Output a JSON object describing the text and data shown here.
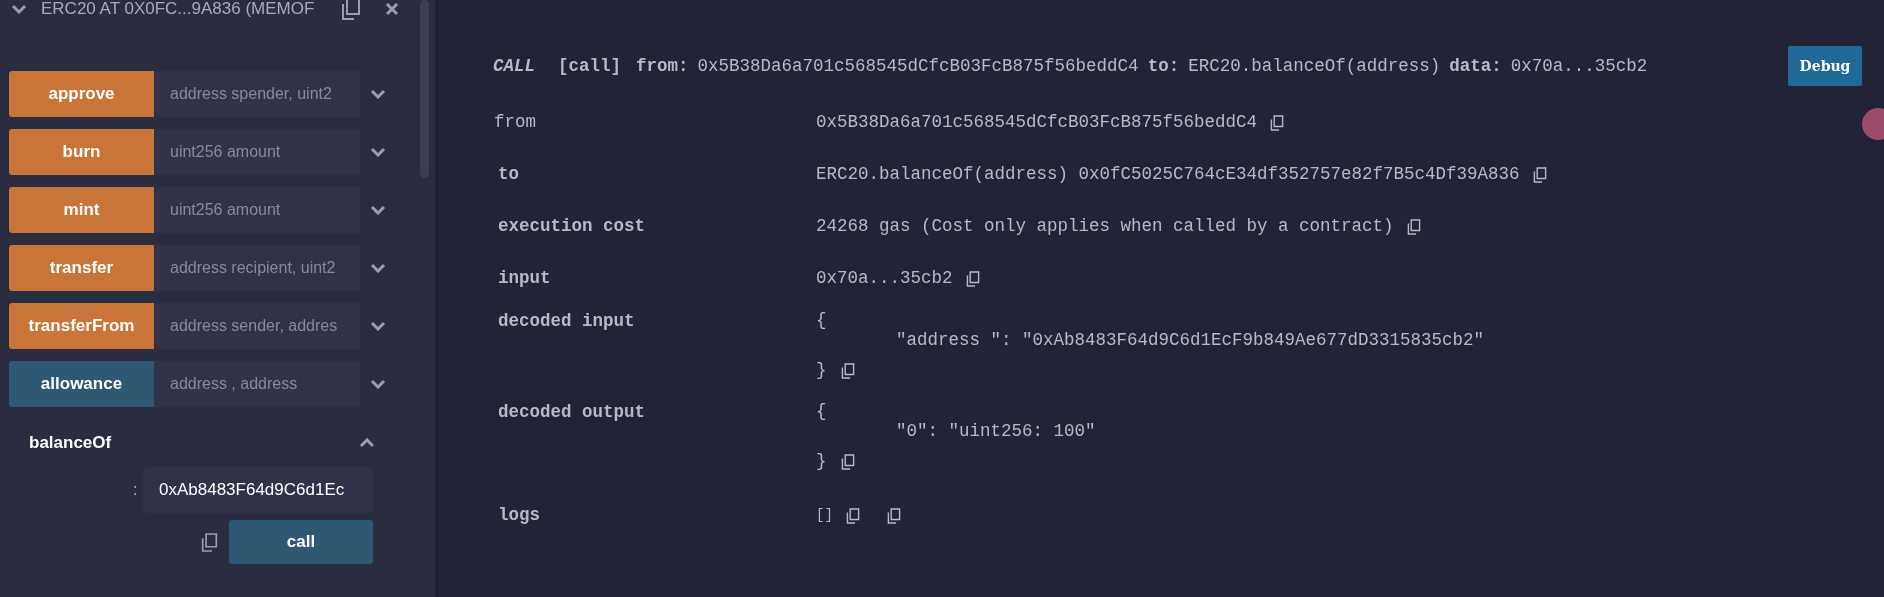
{
  "instance": {
    "title": "ERC20 AT 0X0FC...9A836 (MEMOF",
    "expanded": true
  },
  "functions": [
    {
      "name": "approve",
      "kind": "transact",
      "placeholder": "address spender, uint2"
    },
    {
      "name": "burn",
      "kind": "transact",
      "placeholder": "uint256 amount"
    },
    {
      "name": "mint",
      "kind": "transact",
      "placeholder": "uint256 amount"
    },
    {
      "name": "transfer",
      "kind": "transact",
      "placeholder": "address recipient, uint2"
    },
    {
      "name": "transferFrom",
      "kind": "transact",
      "placeholder": "address sender, addres"
    },
    {
      "name": "allowance",
      "kind": "call",
      "placeholder": "address , address"
    }
  ],
  "open_function": {
    "name": "balanceOf",
    "expanded": true,
    "param_label": ":",
    "value": "0xAb8483F64d9C6d1Ec",
    "button": "call"
  },
  "log": {
    "tag": "CALL",
    "type": "[call]",
    "from_label": "from:",
    "from": "0x5B38Da6a701c568545dCfcB03FcB875f56beddC4",
    "to_label": "to:",
    "to": "ERC20.balanceOf(address)",
    "data_label": "data:",
    "data": "0x70a...35cb2",
    "debug": "Debug"
  },
  "details": [
    {
      "label": "from",
      "emphasis": false,
      "kind": "text",
      "value": "0x5B38Da6a701c568545dCfcB03FcB875f56beddC4"
    },
    {
      "label": "to",
      "emphasis": true,
      "kind": "text",
      "value": "ERC20.balanceOf(address) 0x0fC5025C764cE34df352757e82f7B5c4Df39A836"
    },
    {
      "label": "execution cost",
      "emphasis": true,
      "kind": "text",
      "value": "24268 gas (Cost only applies when called by a contract)"
    },
    {
      "label": "input",
      "emphasis": true,
      "kind": "text",
      "value": "0x70a...35cb2"
    },
    {
      "label": "decoded input",
      "emphasis": true,
      "kind": "object",
      "open": "{",
      "lines": [
        "\"address \": \"0xAb8483F64d9C6d1EcF9b849Ae677dD3315835cb2\""
      ],
      "close": "}"
    },
    {
      "label": "decoded output",
      "emphasis": true,
      "kind": "object",
      "open": "{",
      "lines": [
        "\"0\": \"uint256: 100\""
      ],
      "close": "}"
    },
    {
      "label": "logs",
      "emphasis": true,
      "kind": "logs",
      "value": "[]"
    }
  ]
}
